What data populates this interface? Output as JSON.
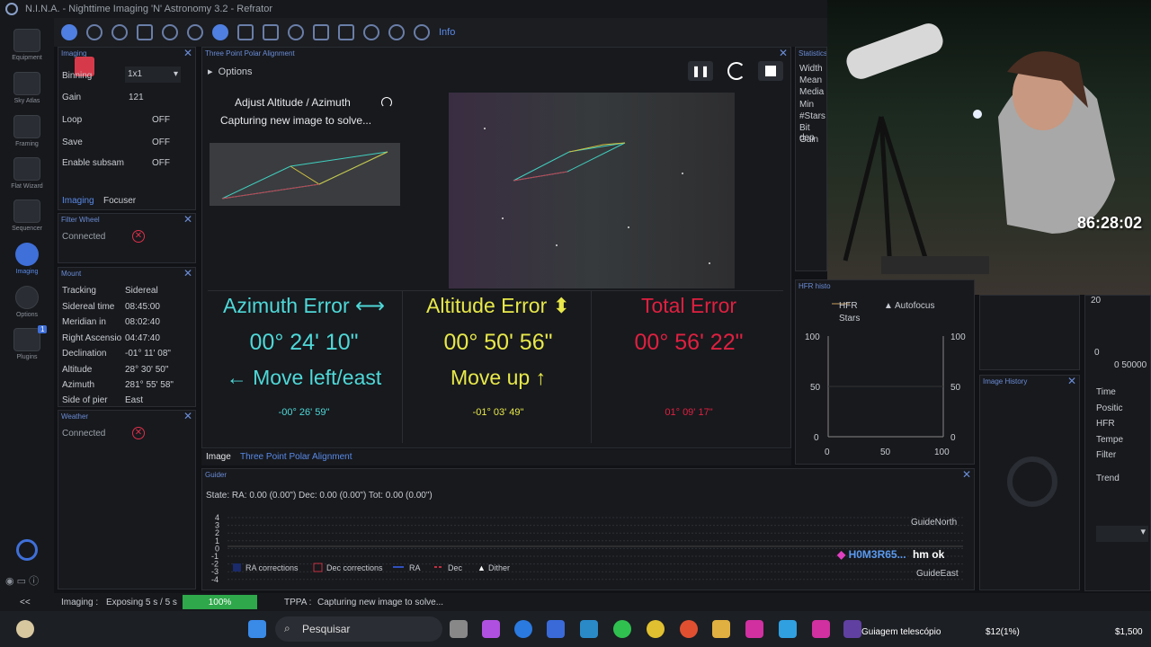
{
  "app": {
    "title": "N.I.N.A. - Nighttime Imaging 'N' Astronomy 3.2   -   Refrator"
  },
  "nav": [
    {
      "label": "Equipment"
    },
    {
      "label": "Sky Atlas"
    },
    {
      "label": "Framing"
    },
    {
      "label": "Flat Wizard"
    },
    {
      "label": "Sequencer"
    },
    {
      "label": "Imaging"
    },
    {
      "label": "Options"
    },
    {
      "label": "Plugins",
      "badge": "1"
    }
  ],
  "toolbar": {
    "info_label": "Info"
  },
  "imaging_panel": {
    "title": "Imaging",
    "rows": [
      {
        "label": "Binning",
        "value": "1x1"
      },
      {
        "label": "Gain",
        "value": "121"
      },
      {
        "label": "Loop",
        "value": "OFF"
      },
      {
        "label": "Save",
        "value": "OFF"
      },
      {
        "label": "Enable subsam",
        "value": "OFF"
      }
    ],
    "tabs": [
      "Imaging",
      "Focuser"
    ]
  },
  "filter_wheel": {
    "title": "Filter Wheel",
    "status": "Connected"
  },
  "mount": {
    "title": "Mount",
    "rows": [
      {
        "label": "Tracking",
        "value": "Sidereal"
      },
      {
        "label": "Sidereal time",
        "value": "08:45:00"
      },
      {
        "label": "Meridian in",
        "value": "08:02:40"
      },
      {
        "label": "Right Ascensio",
        "value": "04:47:40"
      },
      {
        "label": "Declination",
        "value": "-01° 11' 08\""
      },
      {
        "label": "Altitude",
        "value": "28° 30' 50\""
      },
      {
        "label": "Azimuth",
        "value": "281° 55' 58\""
      },
      {
        "label": "Side of pier",
        "value": "East"
      }
    ]
  },
  "weather": {
    "title": "Weather",
    "status": "Connected"
  },
  "tppa": {
    "title": "Three Point Polar Alignment",
    "options_label": "Options",
    "step_title": "Adjust Altitude / Azimuth",
    "step_status": "Capturing new image to solve...",
    "azimuth": {
      "label": "Azimuth Error ⟷",
      "value": "00° 24' 10\"",
      "move": "← Move left/east",
      "detail": "-00° 26' 59\""
    },
    "altitude": {
      "label": "Altitude Error ⬍",
      "value": "00° 50' 56\"",
      "move": "Move up ↑",
      "detail": "-01° 03' 49\""
    },
    "total": {
      "label": "Total Error",
      "value": "00° 56' 22\"",
      "detail": "01° 09' 17\""
    },
    "tabs": [
      "Image",
      "Three Point Polar Alignment"
    ]
  },
  "statistics": {
    "title": "Statistics",
    "rows": [
      "Width",
      "Mean",
      "Media",
      "Min",
      "#Stars",
      "Bit dep",
      "Gain"
    ]
  },
  "hfr": {
    "title": "HFR histo",
    "legend": [
      "HFR",
      "Autofocus",
      "Stars"
    ],
    "yticks": [
      "100",
      "50",
      "0"
    ],
    "xticks": [
      "0",
      "50",
      "100"
    ]
  },
  "image_history": {
    "title": "Image History"
  },
  "right_panel": {
    "rows": [
      "Time",
      "Positic",
      "HFR",
      "Tempe",
      "Filter",
      "Trend"
    ],
    "axis": [
      "20",
      "0",
      "0 50",
      "000"
    ]
  },
  "guider": {
    "title": "Guider",
    "state": "State:  RA: 0.00 (0.00\")  Dec: 0.00 (0.00\")  Tot: 0.00 (0.00\")",
    "yticks": [
      "4",
      "3",
      "2",
      "1",
      "0",
      "-1",
      "-2",
      "-3",
      "-4"
    ],
    "north": "GuideNorth",
    "east": "GuideEast",
    "legend": [
      "RA corrections",
      "Dec corrections",
      "RA",
      "Dec",
      "Dither"
    ]
  },
  "chat": {
    "user": "H0M3R65...",
    "message": "hm ok"
  },
  "webcam": {
    "timer": "86:28:02"
  },
  "statusbar": {
    "collapse": "<<",
    "imaging_label": "Imaging :",
    "imaging_text": "Exposing 5 s / 5 s",
    "progress_text": "100%",
    "progress": 1.0,
    "tppa_label": "TPPA :",
    "tppa_text": "Capturing new image to solve..."
  },
  "taskbar": {
    "search": "Pesquisar",
    "window_label": "Guiagem telescópio",
    "stock": "$12(1%)",
    "price": "$1,500"
  }
}
